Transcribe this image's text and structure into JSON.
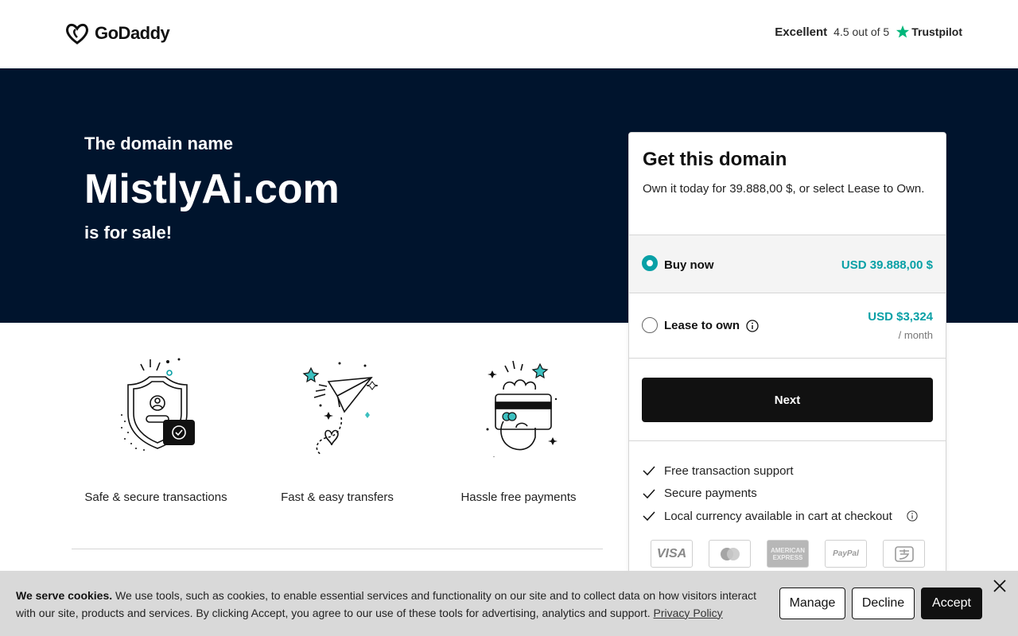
{
  "header": {
    "logo_text": "GoDaddy",
    "trust_rating_word": "Excellent",
    "trust_score": "4.5 out of 5",
    "trust_brand": "Trustpilot"
  },
  "hero": {
    "pre_title": "The domain name",
    "domain": "MistlyAi.com",
    "post_title": "is for sale!"
  },
  "features": [
    {
      "label": "Safe & secure transactions",
      "icon": "shield-check-icon"
    },
    {
      "label": "Fast & easy transfers",
      "icon": "paper-plane-icon"
    },
    {
      "label": "Hassle free payments",
      "icon": "hand-card-icon"
    }
  ],
  "card": {
    "title": "Get this domain",
    "description": "Own it today for 39.888,00 $, or select Lease to Own.",
    "options": [
      {
        "label": "Buy now",
        "price": "USD 39.888,00 $",
        "selected": true
      },
      {
        "label": "Lease to own",
        "price": "USD $3,324",
        "sub": "/ month",
        "selected": false
      }
    ],
    "next_label": "Next",
    "benefits": [
      "Free transaction support",
      "Secure payments",
      "Local currency available in cart at checkout"
    ],
    "payment_methods": [
      "VISA",
      "Mastercard",
      "AMERICAN EXPRESS",
      "PayPal",
      "Alipay"
    ]
  },
  "cookie": {
    "title": "We serve cookies.",
    "body": "We use tools, such as cookies, to enable essential services and functionality on our site and to collect data on how visitors interact with our site, products and services. By clicking Accept, you agree to our use of these tools for advertising, analytics and support.",
    "link": "Privacy Policy",
    "manage_label": "Manage",
    "decline_label": "Decline",
    "accept_label": "Accept"
  },
  "colors": {
    "hero_bg": "#00142d",
    "accent_teal": "#09a0a6",
    "trustpilot_green": "#00b67a",
    "button_dark": "#111111"
  }
}
